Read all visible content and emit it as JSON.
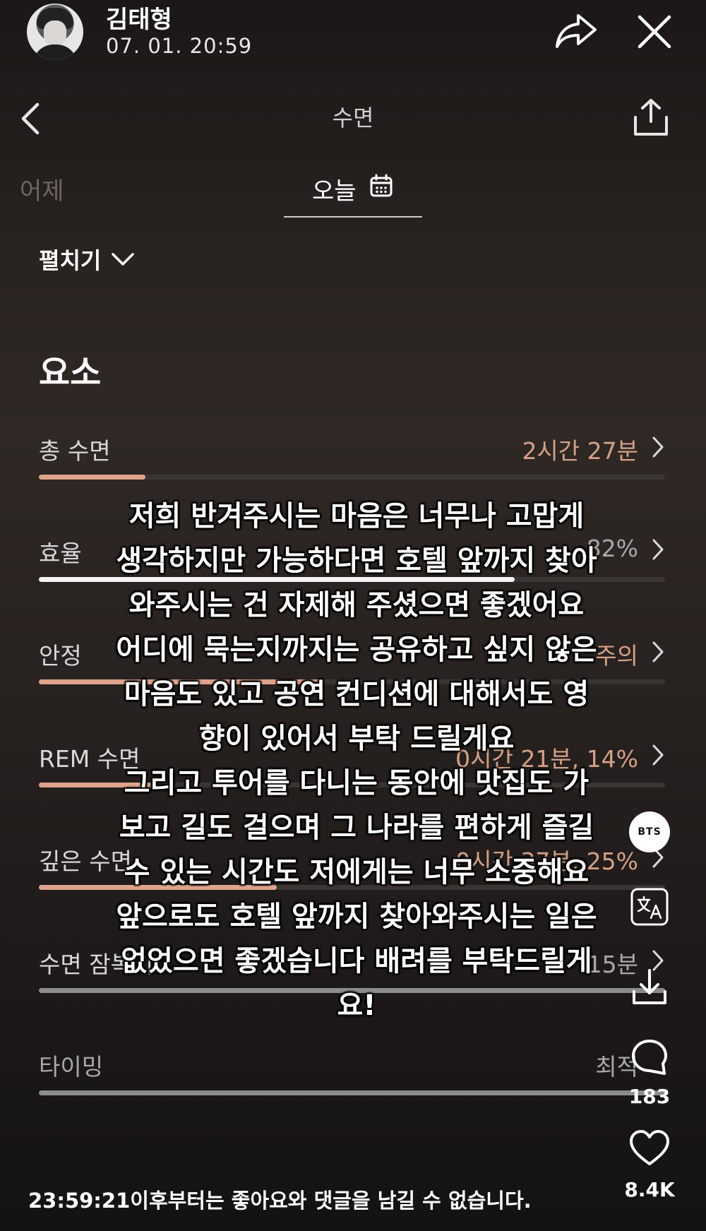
{
  "post": {
    "username": "김태형",
    "timestamp": "07. 01. 20:59"
  },
  "app": {
    "title": "수면",
    "tabs": {
      "previous": "어제",
      "current": "오늘"
    },
    "expand_label": "펼치기",
    "section_title": "요소",
    "metrics": [
      {
        "label": "총 수면",
        "value": "2시간 27분",
        "level": 0.17,
        "bar_color": "#e0a38b"
      },
      {
        "label": "효율",
        "value": "82%",
        "level": 0.76,
        "bar_color": "#f3f3f3"
      },
      {
        "label": "안정",
        "value": "주의",
        "level": 0.45,
        "bar_color": "#e0a38b"
      },
      {
        "label": "REM 수면",
        "value": "0시간 21분, 14%",
        "level": 0.18,
        "bar_color": "#e0a38b"
      },
      {
        "label": "깊은 수면",
        "value": "0시간 37분, 25%",
        "level": 0.38,
        "bar_color": "#e0a38b"
      },
      {
        "label": "수면 잠복기",
        "value": "15분",
        "level": 1.0,
        "bar_color": "#8c8c8c"
      },
      {
        "label": "타이밍",
        "value": "최적",
        "level": 1.0,
        "bar_color": "#8c8c8c"
      }
    ]
  },
  "caption": {
    "lines": [
      "저희 반겨주시는 마음은 너무나 고맙게",
      "생각하지만 가능하다면 호텔 앞까지 찾아",
      "와주시는 건 자제해 주셨으면 좋겠어요",
      "어디에 묵는지까지는 공유하고 싶지 않은",
      "마음도 있고 공연 컨디션에 대해서도 영",
      "향이 있어서 부탁 드릴게요",
      "그리고 투어를 다니는 동안에 맛집도 가",
      "보고 길도 걸으며 그 나라를 편하게 즐길",
      "수 있는 시간도 저에게는 너무 소중해요",
      "앞으로도 호텔 앞까지 찾아와주시는 일은",
      "없었으면 좋겠습니다 배려를 부탁드릴게",
      "요!"
    ]
  },
  "actions": {
    "badge": "BTS",
    "comment_count": "183",
    "like_count": "8.4K"
  },
  "footer": {
    "notice": "23:59:21이후부터는 좋아요와 댓글을 남길 수 없습니다."
  },
  "icons": [
    "share-icon",
    "close-icon",
    "back-chevron-icon",
    "export-icon",
    "calendar-icon",
    "chevron-down-icon",
    "chevron-right-icon",
    "translate-icon",
    "download-icon",
    "comment-icon",
    "heart-icon"
  ],
  "colors": {
    "accent": "#e0a38b",
    "value_text": "#d4a185",
    "track": "#3a3533"
  }
}
